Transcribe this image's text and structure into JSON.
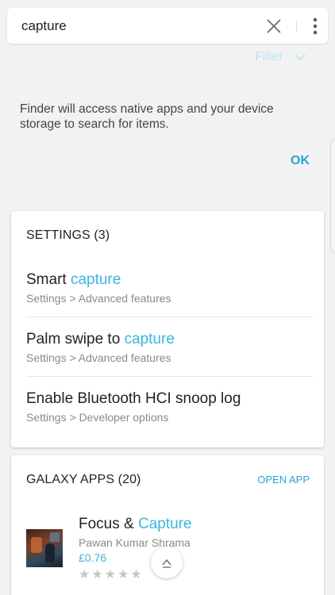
{
  "search": {
    "query": "capture",
    "clear_icon": "close-icon",
    "more_icon": "more-vert-icon"
  },
  "filter": {
    "label": "Filter",
    "icon": "chevron-down-icon"
  },
  "notice": {
    "text": "Finder will access native apps and your device storage to search for items.",
    "ok_label": "OK"
  },
  "settings_card": {
    "header": "SETTINGS (3)",
    "items": [
      {
        "title_prefix": "Smart ",
        "title_match": "capture",
        "subtitle": "Settings > Advanced features"
      },
      {
        "title_prefix": "Palm swipe to ",
        "title_match": "capture",
        "subtitle": "Settings > Advanced features"
      },
      {
        "title_prefix": "Enable Bluetooth HCI snoop log",
        "title_match": "",
        "subtitle": "Settings > Developer options"
      }
    ]
  },
  "apps_card": {
    "header": "GALAXY APPS (20)",
    "open_app_label": "OPEN APP",
    "app": {
      "name_prefix": "Focus & ",
      "name_match": "Capture",
      "developer": "Pawan Kumar Shrama",
      "price": "£0.76",
      "rating": 0,
      "max_rating": 5,
      "stars": "★★★★★"
    }
  },
  "scroll_top_icon": "chevron-up-icon",
  "colors": {
    "accent": "#29a3d6",
    "highlight": "#3cb4e0",
    "filter_text": "#bfe4f2",
    "background": "#f2f2f2"
  }
}
